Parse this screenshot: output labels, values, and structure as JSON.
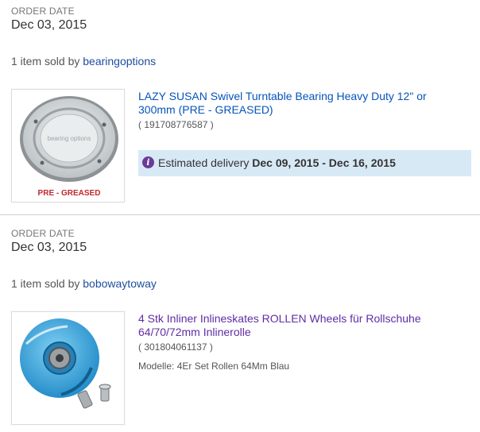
{
  "orders": [
    {
      "date_label": "ORDER DATE",
      "date_value": "Dec 03, 2015",
      "seller_prefix": "1 item sold by",
      "seller_name": "bearingoptions",
      "item_title_line1": "LAZY SUSAN Swivel Turntable Bearing Heavy Duty 12\" or",
      "item_title_line2": "300mm (PRE - GREASED)",
      "item_id": "( 191708776587 )",
      "image_caption": "PRE - GREASED",
      "image_watermark": "bearing options",
      "delivery_label": "Estimated delivery",
      "delivery_dates": "Dec 09, 2015 - Dec 16, 2015"
    },
    {
      "date_label": "ORDER DATE",
      "date_value": "Dec 03, 2015",
      "seller_prefix": "1 item sold by",
      "seller_name": "bobowaytoway",
      "item_title_line1": "4 Stk Inliner Inlineskates ROLLEN Wheels für Rollschuhe",
      "item_title_line2": "64/70/72mm Inlinerolle",
      "item_id": "( 301804061137 )",
      "variation": "Modelle: 4Er Set Rollen 64Mm Blau"
    }
  ],
  "colors": {
    "link": "#1d4d9e",
    "title_link": "#0654ba",
    "visited_link": "#5f2ca5",
    "delivery_bg": "#d8e9f6",
    "info_icon": "#6a3b97",
    "caption_red": "#c0282d"
  }
}
